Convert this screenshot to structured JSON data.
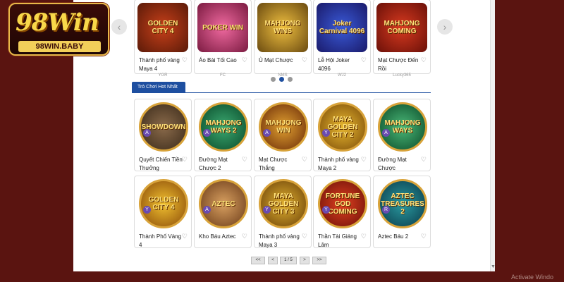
{
  "brand": {
    "logo_text": "98Win",
    "domain": "98WIN.BABY"
  },
  "carousel": {
    "items": [
      {
        "name": "Thành phố vàng Maya 4",
        "provider": "YGR",
        "art": "GOLDEN CITY 4"
      },
      {
        "name": "Áo Bài Tối Cao",
        "provider": "FC",
        "art": "POKER WIN"
      },
      {
        "name": "Ù Mạt Chược",
        "provider": "NMS",
        "art": "MAHJONG WINS"
      },
      {
        "name": "Lễ Hội Joker 4096",
        "provider": "WJ2",
        "art": "Joker Carnival 4096"
      },
      {
        "name": "Mạt Chược Đến Rồi",
        "provider": "Lucky365",
        "art": "MAHJONG COMING"
      }
    ],
    "page_dots": 3,
    "active_dot": 1
  },
  "section": {
    "title": "Trò Chơi Hot Nhất"
  },
  "games": [
    {
      "name": "Quyết Chiến Tiền Thưởng",
      "art": "SHOWDOWN",
      "chip": "A"
    },
    {
      "name": "Đường Mạt Chược 2",
      "art": "MAHJONG WAYS 2",
      "chip": "A"
    },
    {
      "name": "Mạt Chược Thắng",
      "art": "MAHJONG WIN",
      "chip": "A"
    },
    {
      "name": "Thành phố vàng Maya 2",
      "art": "MAYA GOLDEN CITY 2",
      "chip": "Y"
    },
    {
      "name": "Đường Mạt Chược",
      "art": "MAHJONG WAYS",
      "chip": "A"
    },
    {
      "name": "Thành Phố Vàng 4",
      "art": "GOLDEN CITY 4",
      "chip": "Y"
    },
    {
      "name": "Kho Báu Aztec",
      "art": "AZTEC",
      "chip": "A"
    },
    {
      "name": "Thành phố vàng Maya 3",
      "art": "MAYA GOLDEN CITY 3",
      "chip": "Y"
    },
    {
      "name": "Thần Tài Giáng Lâm",
      "art": "FORTUNE GOD COMING",
      "chip": "Y"
    },
    {
      "name": "Aztec Báu 2",
      "art": "AZTEC TREASURES 2",
      "chip": "R"
    }
  ],
  "pagination": {
    "first": "<<",
    "prev": "<",
    "current": "1 / 5",
    "next": ">",
    "last": ">>"
  },
  "nav": {
    "prev_arrow": "‹",
    "next_arrow": "›"
  },
  "watermark": "Activate Windo",
  "icons": {
    "heart": "heart-icon",
    "chevron-left": "chevron-left-icon",
    "chevron-right": "chevron-right-icon"
  },
  "colors": {
    "background": "#5a1410",
    "accent": "#1e4fa0",
    "gold": "#e8b84a"
  }
}
